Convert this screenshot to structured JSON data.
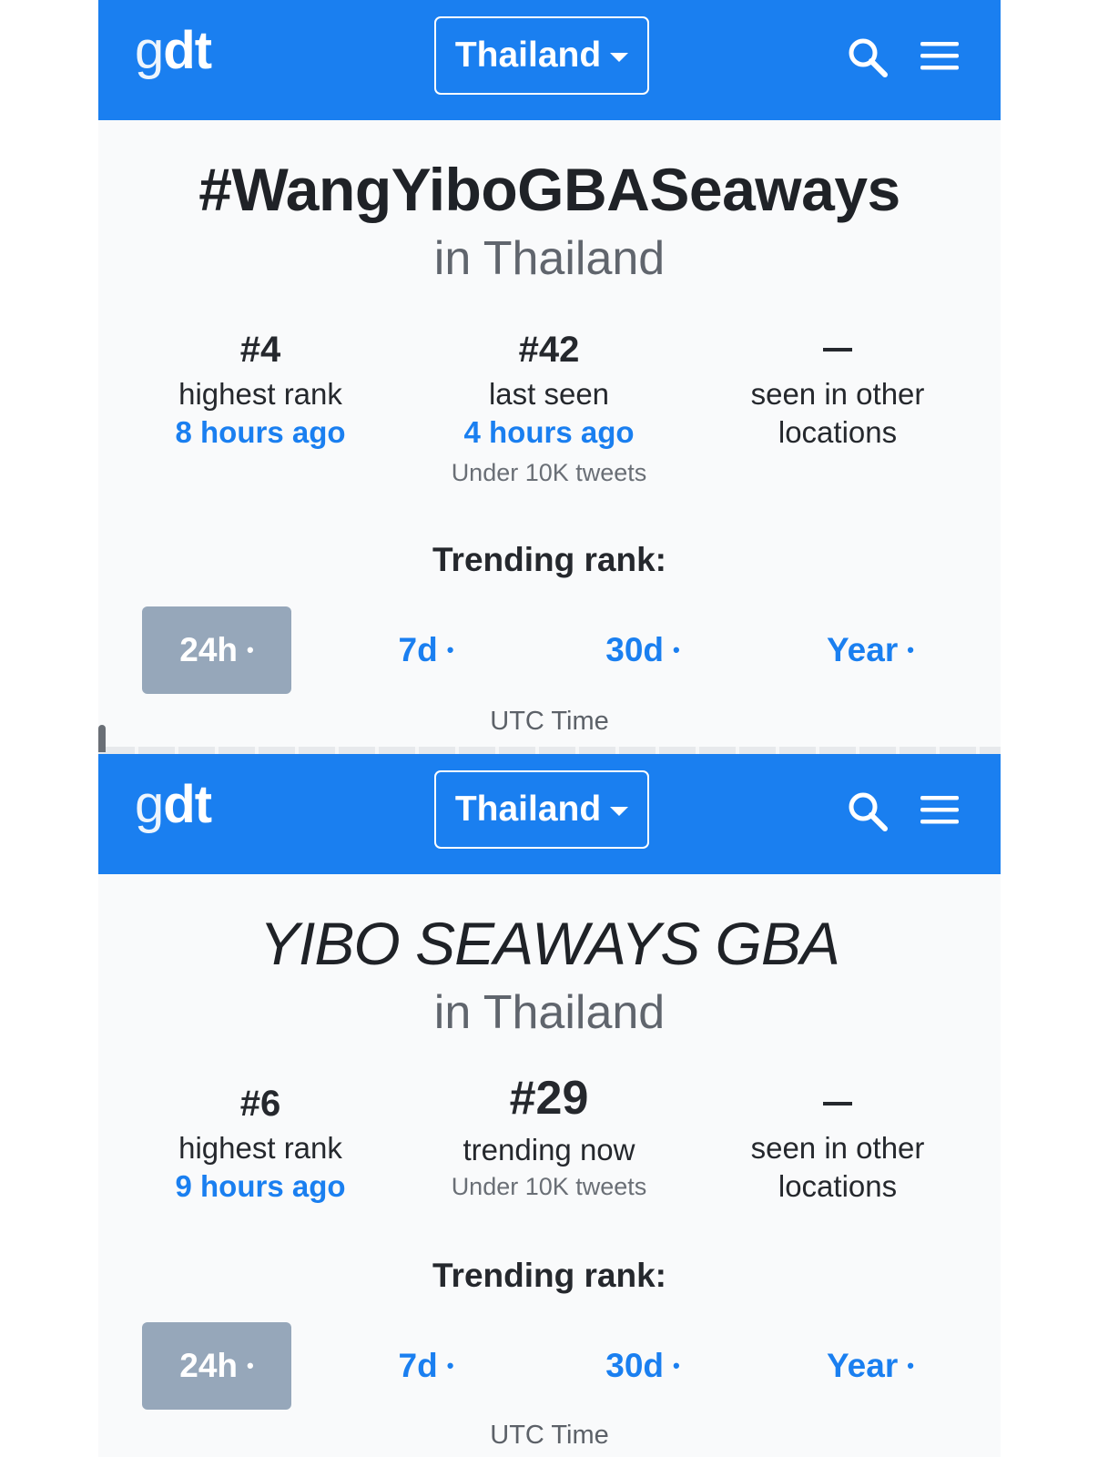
{
  "screens": [
    {
      "logo": "gdt",
      "country": "Thailand",
      "title": "#WangYiboGBASeaways",
      "location": "in Thailand",
      "stats": [
        {
          "rank": "#4",
          "label": "highest rank",
          "time": "8 hours ago"
        },
        {
          "rank": "#42",
          "label": "last seen",
          "time": "4 hours ago",
          "tweets": "Under 10K tweets"
        },
        {
          "label_line1": "seen in other",
          "label_line2": "locations"
        }
      ],
      "section_title": "Trending rank:",
      "ranges": [
        "24h",
        "7d",
        "30d",
        "Year"
      ],
      "range_dot": "•",
      "active_range": "24h",
      "timezone_note": "UTC Time"
    },
    {
      "logo": "gdt",
      "country": "Thailand",
      "title": "YIBO SEAWAYS GBA",
      "location": "in Thailand",
      "stats": [
        {
          "rank": "#6",
          "label": "highest rank",
          "time": "9 hours ago"
        },
        {
          "rank": "#29",
          "label": "trending now",
          "tweets": "Under 10K tweets"
        },
        {
          "label_line1": "seen in other",
          "label_line2": "locations"
        }
      ],
      "section_title": "Trending rank:",
      "ranges": [
        "24h",
        "7d",
        "30d",
        "Year"
      ],
      "range_dot": "•",
      "active_range": "24h",
      "timezone_note": "UTC Time"
    }
  ],
  "colors": {
    "brand_blue": "#1a7ff0",
    "active_tab_gray": "#96a7ba",
    "page_background": "#f9fafb"
  },
  "icons": [
    "search-icon",
    "hamburger-menu-icon",
    "caret-down-icon"
  ]
}
